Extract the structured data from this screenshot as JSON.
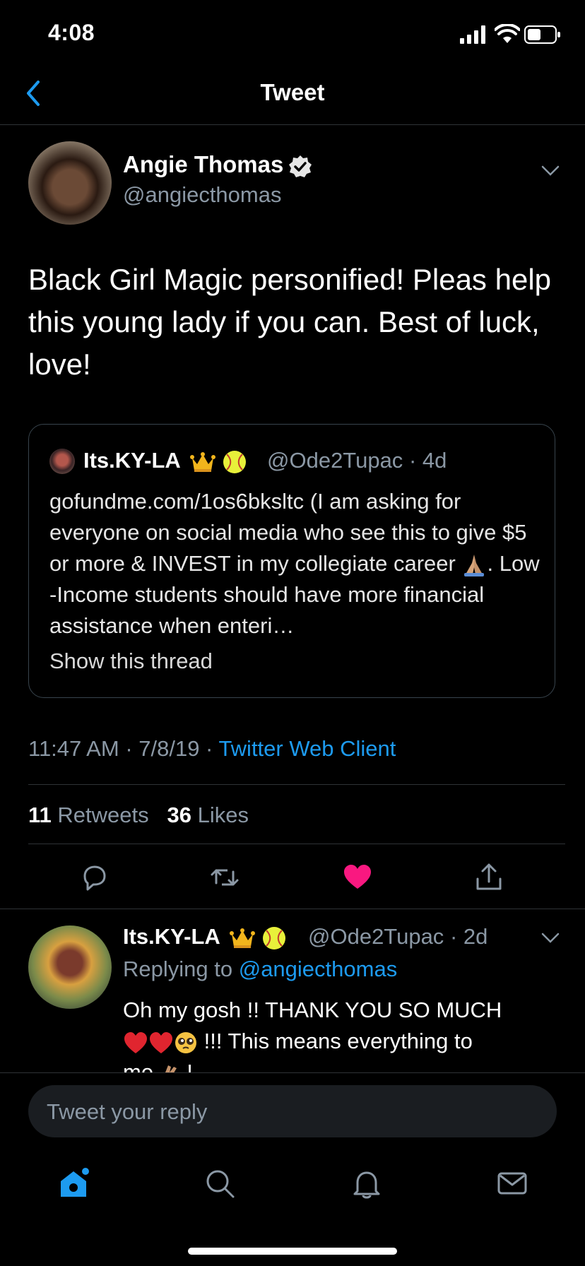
{
  "status_bar": {
    "time": "4:08"
  },
  "nav": {
    "title": "Tweet"
  },
  "tweet": {
    "author_name": "Angie Thomas",
    "author_handle": "@angiecthomas",
    "text": "Black Girl Magic personified! Pleas help this young lady if you can. Best of luck, love!",
    "quoted": {
      "author_name": "Its.KY-LA",
      "author_handle": "@Ode2Tupac",
      "age": "· 4d",
      "text_before_emoji": "gofundme.com/1os6bksltc (I am asking for everyone on social media who see this to give $5 or more & INVEST in my collegiate career ",
      "text_after_emoji": ". Low -Income students should have more financial assistance when enteri…",
      "show_thread": "Show this thread"
    },
    "time": "11:47 AM",
    "date": "· 7/8/19 ·",
    "client": "Twitter Web Client",
    "retweets_count": "11",
    "retweets_label": "Retweets",
    "likes_count": "36",
    "likes_label": "Likes"
  },
  "reply": {
    "author_name": "Its.KY-LA",
    "author_handle": "@Ode2Tupac",
    "age": "· 2d",
    "replying_prefix": "Replying to",
    "replying_mention": "@angiecthomas",
    "text_line1": "Oh my gosh !!  THANK YOU SO MUCH",
    "text_line2": " !!! This means everything to",
    "text_line3": "me ",
    "text_line3_end": " !"
  },
  "composer": {
    "placeholder": "Tweet your reply"
  },
  "colors": {
    "accent": "#1d9bf0",
    "like": "#f91880",
    "muted": "#8b98a5"
  },
  "icons": [
    "back-chevron-icon",
    "verified-badge-icon",
    "chevron-down-icon",
    "reply-icon",
    "retweet-icon",
    "like-heart-icon",
    "share-icon",
    "home-icon",
    "search-icon",
    "notifications-bell-icon",
    "messages-envelope-icon"
  ]
}
